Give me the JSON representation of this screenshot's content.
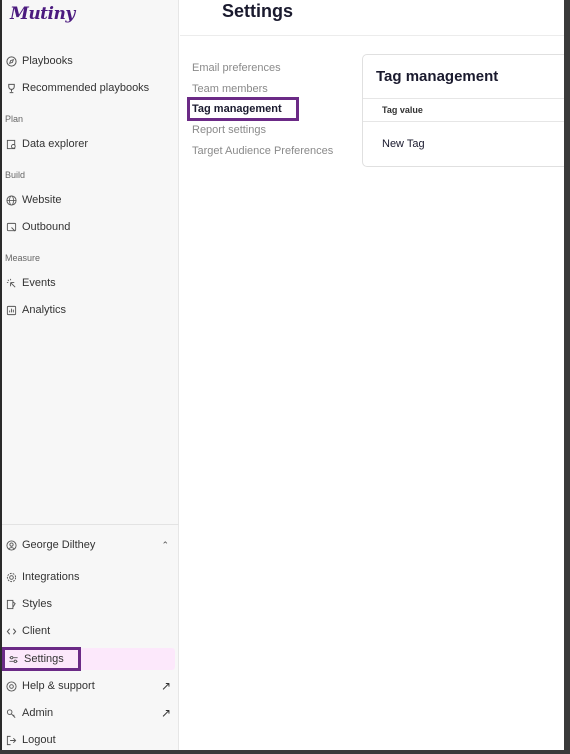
{
  "brand": {
    "logo_text": "Mutiny",
    "accent": "#4b1a7f",
    "highlight": "#6b2a86",
    "active_bg": "#fce8fb"
  },
  "sidebar": {
    "top_items": [
      {
        "label": "Playbooks",
        "icon": "compass-icon"
      },
      {
        "label": "Recommended playbooks",
        "icon": "trophy-icon"
      }
    ],
    "sections": [
      {
        "label": "Plan",
        "items": [
          {
            "label": "Data explorer",
            "icon": "data-explorer-icon"
          }
        ]
      },
      {
        "label": "Build",
        "items": [
          {
            "label": "Website",
            "icon": "globe-icon"
          },
          {
            "label": "Outbound",
            "icon": "outbound-icon"
          }
        ]
      },
      {
        "label": "Measure",
        "items": [
          {
            "label": "Events",
            "icon": "click-icon"
          },
          {
            "label": "Analytics",
            "icon": "analytics-icon"
          }
        ]
      }
    ],
    "user": {
      "name": "George Dilthey",
      "icon": "user-circle-icon"
    },
    "bottom_items": [
      {
        "label": "Integrations",
        "icon": "gear-icon"
      },
      {
        "label": "Styles",
        "icon": "styles-icon"
      },
      {
        "label": "Client",
        "icon": "code-icon"
      },
      {
        "label": "Settings",
        "icon": "sliders-icon"
      },
      {
        "label": "Help & support",
        "icon": "lifebuoy-icon"
      },
      {
        "label": "Admin",
        "icon": "key-icon"
      },
      {
        "label": "Logout",
        "icon": "logout-icon"
      }
    ]
  },
  "main": {
    "title": "Settings",
    "subnav": [
      "Email preferences",
      "Team members",
      "Tag management",
      "Report settings",
      "Target Audience Preferences"
    ],
    "active_subnav": "Tag management",
    "card": {
      "title": "Tag management",
      "column_header": "Tag value",
      "rows": [
        "New Tag"
      ]
    }
  }
}
